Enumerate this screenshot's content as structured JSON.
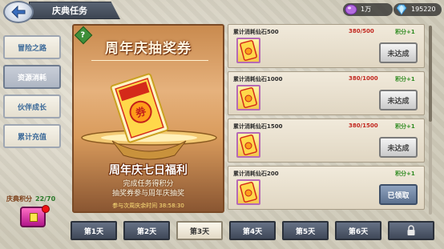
{
  "header": {
    "title": "庆典任务",
    "currencies": [
      {
        "icon": "purple-gem-icon",
        "value": "1万"
      },
      {
        "icon": "diamond-icon",
        "value": "195220"
      }
    ]
  },
  "sidebar": {
    "items": [
      {
        "label": "冒险之路",
        "active": false
      },
      {
        "label": "资源消耗",
        "active": true
      },
      {
        "label": "伙伴成长",
        "active": false
      },
      {
        "label": "累计充值",
        "active": false
      }
    ]
  },
  "points": {
    "label": "庆典积分",
    "count": "22/70"
  },
  "banner": {
    "title": "周年庆抽奖券",
    "subtitle": "周年庆七日福利",
    "desc_line1": "完成任务得积分",
    "desc_line2": "抽奖券参与周年庆抽奖",
    "timer": "参与次周庆余时间 38:58:30"
  },
  "tasks": [
    {
      "name": "累计消耗仙石500",
      "progress": "380/500",
      "reward": "积分+1",
      "button": "未达成",
      "claimed": false
    },
    {
      "name": "累计消耗仙石1000",
      "progress": "380/1000",
      "reward": "积分+1",
      "button": "未达成",
      "claimed": false
    },
    {
      "name": "累计消耗仙石1500",
      "progress": "380/1500",
      "reward": "积分+1",
      "button": "未达成",
      "claimed": false
    },
    {
      "name": "累计消耗仙石200",
      "progress": "",
      "reward": "积分+1",
      "button": "已领取",
      "claimed": true
    }
  ],
  "day_tabs": [
    {
      "label": "第1天",
      "active": false
    },
    {
      "label": "第2天",
      "active": false
    },
    {
      "label": "第3天",
      "active": true
    },
    {
      "label": "第4天",
      "active": false
    },
    {
      "label": "第5天",
      "active": false
    },
    {
      "label": "第6天",
      "active": false
    },
    {
      "label": "",
      "locked": true
    }
  ],
  "colors": {
    "accent_red": "#c2261e",
    "reward_green": "#2e8b20",
    "tab_dark": "#3f4858"
  }
}
